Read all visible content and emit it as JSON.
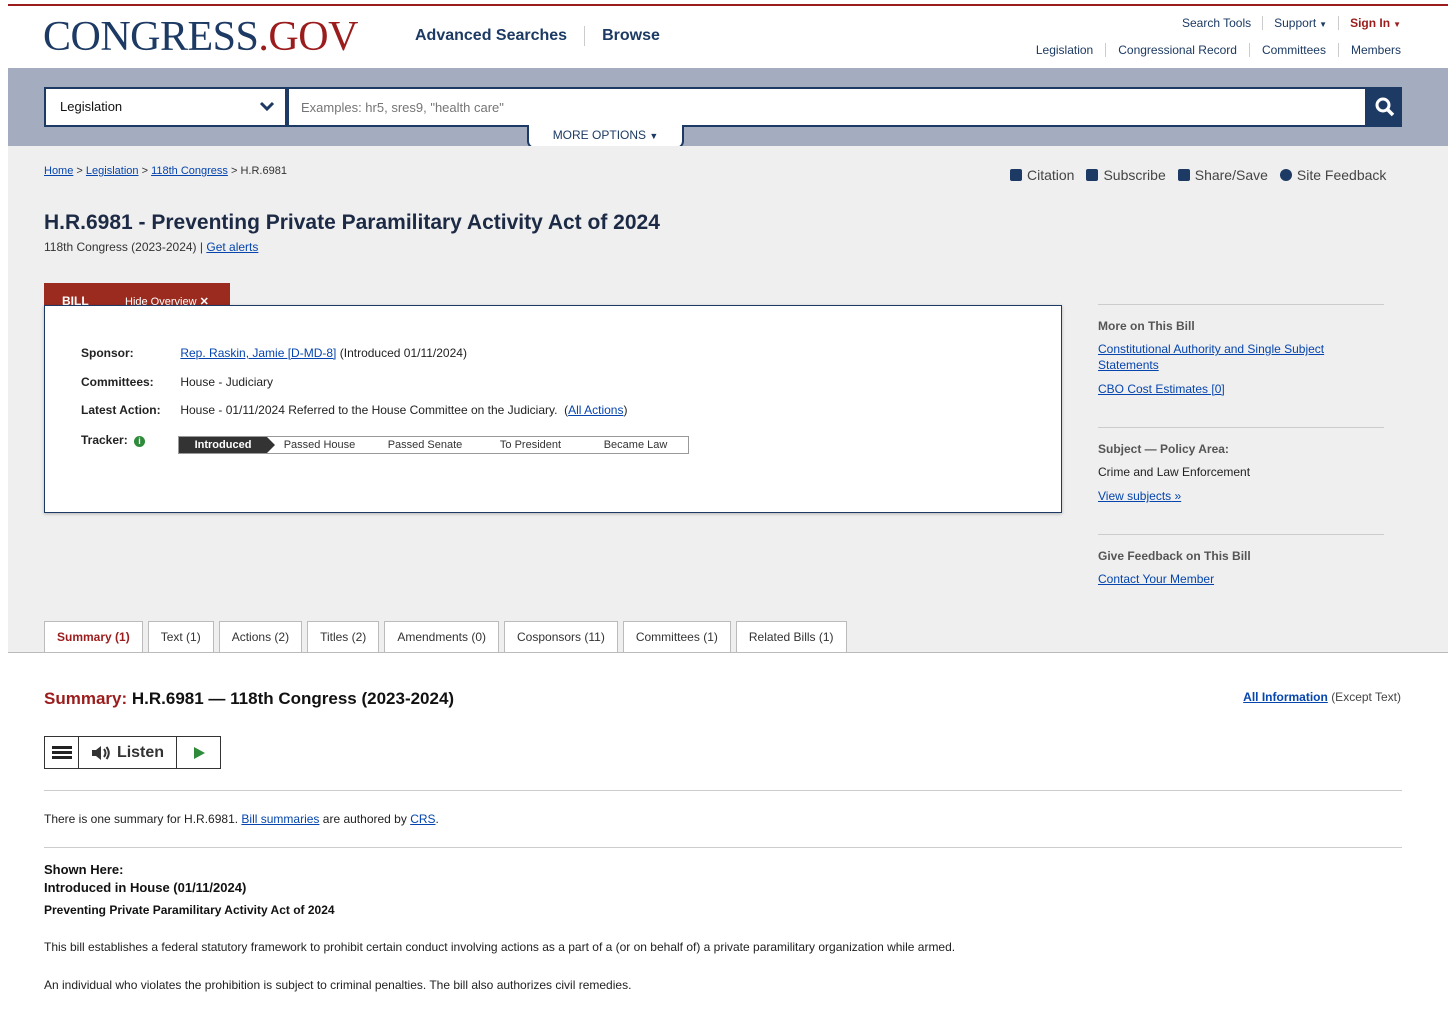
{
  "header": {
    "logo_main": "CONGRESS",
    "logo_dot": ".",
    "logo_tld": "GOV",
    "nav": [
      "Advanced Searches",
      "Browse"
    ],
    "util": {
      "search_tools": "Search Tools",
      "support": "Support",
      "sign_in": "Sign In"
    },
    "subnav": [
      "Legislation",
      "Congressional Record",
      "Committees",
      "Members"
    ]
  },
  "search": {
    "scope": "Legislation",
    "placeholder": "Examples: hr5, sres9, \"health care\"",
    "more_options": "MORE OPTIONS"
  },
  "breadcrumb": {
    "home": "Home",
    "legislation": "Legislation",
    "congress": "118th Congress",
    "current": "H.R.6981",
    "sep": ">"
  },
  "tools": [
    "Citation",
    "Subscribe",
    "Share/Save",
    "Site Feedback"
  ],
  "bill": {
    "title": "H.R.6981 - Preventing Private Paramilitary Activity Act of 2024",
    "congress": "118th Congress (2023-2024)",
    "divider": "|",
    "get_alerts": "Get alerts",
    "tab_label": "BILL",
    "hide_overview": "Hide Overview",
    "sponsor_label": "Sponsor:",
    "sponsor_link": "Rep. Raskin, Jamie [D-MD-8]",
    "sponsor_intro": "(Introduced 01/11/2024)",
    "committees_label": "Committees:",
    "committees": "House - Judiciary",
    "latest_label": "Latest Action:",
    "latest_action": "House - 01/11/2024 Referred to the House Committee on the Judiciary.",
    "all_actions": "All Actions",
    "tracker_label": "Tracker:",
    "tracker": [
      "Introduced",
      "Passed House",
      "Passed Senate",
      "To President",
      "Became Law"
    ]
  },
  "sidebar": {
    "more_title": "More on This Bill",
    "more_link1": "Constitutional Authority and Single Subject Statements",
    "more_link2": "CBO Cost Estimates [0]",
    "subject_title": "Subject — Policy Area:",
    "subject": "Crime and Law Enforcement",
    "view_subjects": "View subjects",
    "feedback_title": "Give Feedback on This Bill",
    "contact": "Contact Your Member"
  },
  "tabs": [
    "Summary (1)",
    "Text (1)",
    "Actions (2)",
    "Titles (2)",
    "Amendments (0)",
    "Cosponsors (11)",
    "Committees (1)",
    "Related Bills (1)"
  ],
  "summary": {
    "label": "Summary:",
    "heading": "H.R.6981 — 118th Congress (2023-2024)",
    "all_info": "All Information",
    "except_text": "(Except Text)",
    "listen": "Listen",
    "intro_pre": "There is one summary for H.R.6981.",
    "intro_link": "Bill summaries",
    "intro_mid": "are authored by",
    "intro_crs": "CRS",
    "shown_here": "Shown Here:",
    "version": "Introduced in House (01/11/2024)",
    "act_name": "Preventing Private Paramilitary Activity Act of 2024",
    "para1": "This bill establishes a federal statutory framework to prohibit certain conduct involving actions as a part of a (or on behalf of) a private paramilitary organization while armed.",
    "para2": "An individual who violates the prohibition is subject to criminal penalties. The bill also authorizes civil remedies."
  },
  "colors": {
    "brand_blue": "#1c3a63",
    "brand_red": "#9b1c1c",
    "link": "#0645ad"
  }
}
